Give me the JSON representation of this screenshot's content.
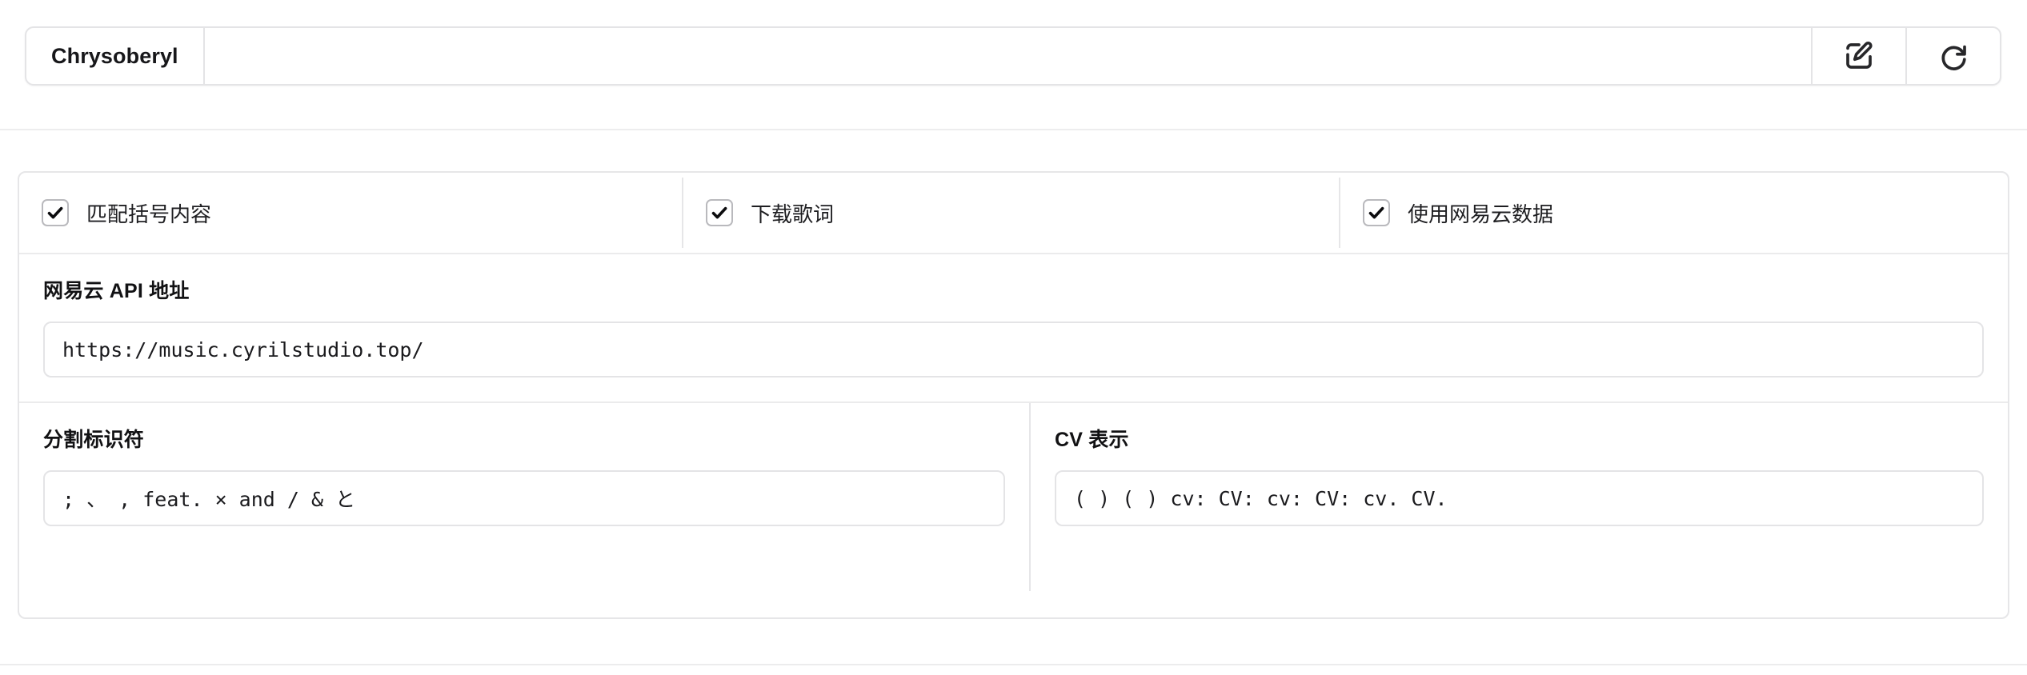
{
  "header": {
    "title": "Chrysoberyl",
    "buttons": [
      {
        "name": "edit",
        "icon": "edit-square-icon",
        "label": ""
      },
      {
        "name": "refresh",
        "icon": "refresh-icon",
        "label": ""
      }
    ]
  },
  "options": {
    "checkboxes": [
      {
        "label": "匹配括号内容",
        "checked": true
      },
      {
        "label": "下载歌词",
        "checked": true
      },
      {
        "label": "使用网易云数据",
        "checked": true
      }
    ]
  },
  "api": {
    "label": "网易云 API 地址",
    "value": "https://music.cyrilstudio.top/",
    "placeholder": "https://music.cyrilstudio.top/"
  },
  "separator": {
    "label": "分割标识符",
    "value": "; 、 , feat. × and / & と",
    "placeholder": "; 、 , feat. × and / & と"
  },
  "cv": {
    "label": "CV 表示",
    "value": "( ) ( ) cv: CV: cv: CV: cv. CV.",
    "placeholder": "( ) ( ) cv: CV: cv: CV: cv. CV."
  },
  "colors": {
    "border": "#e4e4e6",
    "divider": "#ebebec",
    "text": "#1c1c1e",
    "background": "#ffffff"
  }
}
